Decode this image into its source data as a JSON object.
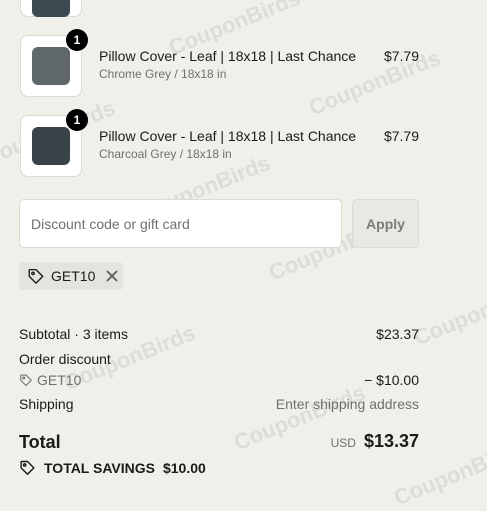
{
  "items": [
    {
      "quantity": "1",
      "title": "Pillow Cover - Leaf | 18x18 | Last Chance",
      "variant": "Chrome Grey / 18x18 in",
      "price": "$7.79",
      "color": "#5c6466"
    },
    {
      "quantity": "1",
      "title": "Pillow Cover - Leaf | 18x18 | Last Chance",
      "variant": "Charcoal Grey / 18x18 in",
      "price": "$7.79",
      "color": "#3a4347"
    }
  ],
  "discount": {
    "placeholder": "Discount code or gift card",
    "apply_label": "Apply",
    "applied_code": "GET10"
  },
  "summary": {
    "subtotal_label": "Subtotal · 3 items",
    "subtotal_value": "$23.37",
    "order_discount_label": "Order discount",
    "discount_code": "GET10",
    "discount_value": "− $10.00",
    "shipping_label": "Shipping",
    "shipping_value": "Enter shipping address",
    "total_label": "Total",
    "currency": "USD",
    "total_value": "$13.37",
    "savings_label": "TOTAL SAVINGS",
    "savings_value": "$10.00"
  },
  "watermark": "CouponBirds"
}
